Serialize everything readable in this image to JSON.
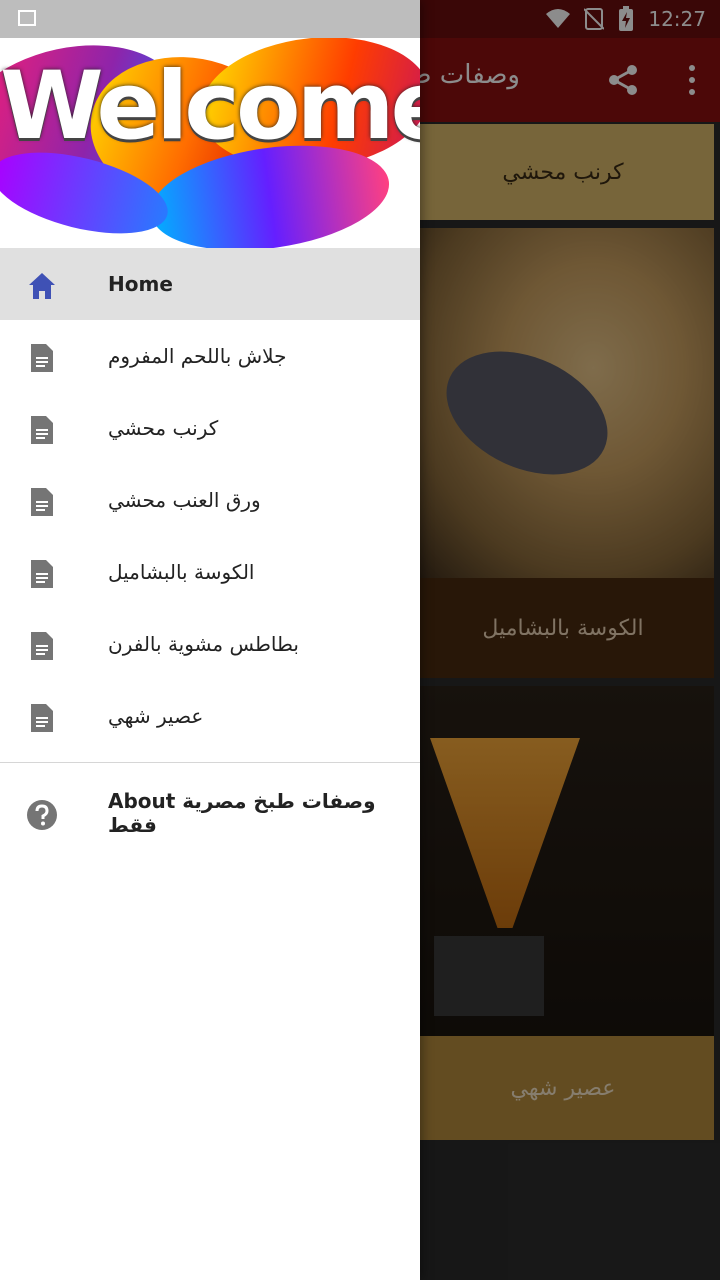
{
  "status": {
    "time": "12:27"
  },
  "app": {
    "title": "وصفات ص",
    "cards": [
      {
        "title": "كرنب محشي"
      },
      {
        "caption": "الكوسة بالبشاميل"
      },
      {
        "caption": "عصير شهي"
      }
    ]
  },
  "drawer": {
    "header": {
      "welcome": "Welcome"
    },
    "items": [
      {
        "label": "Home",
        "icon": "home-icon"
      },
      {
        "label": "جلاش باللحم المفروم",
        "icon": "document-icon"
      },
      {
        "label": "كرنب محشي",
        "icon": "document-icon"
      },
      {
        "label": "ورق العنب محشي",
        "icon": "document-icon"
      },
      {
        "label": "الكوسة بالبشاميل",
        "icon": "document-icon"
      },
      {
        "label": "بطاطس مشوية بالفرن",
        "icon": "document-icon"
      },
      {
        "label": "عصير شهي",
        "icon": "document-icon"
      }
    ],
    "about": {
      "label": "About وصفات طبخ مصرية فقط",
      "icon": "help-icon"
    }
  },
  "colors": {
    "appbar": "#8b1010",
    "status": "#6b0d0d",
    "accent": "#3f51b5",
    "active_bg": "#e0e0e0"
  }
}
